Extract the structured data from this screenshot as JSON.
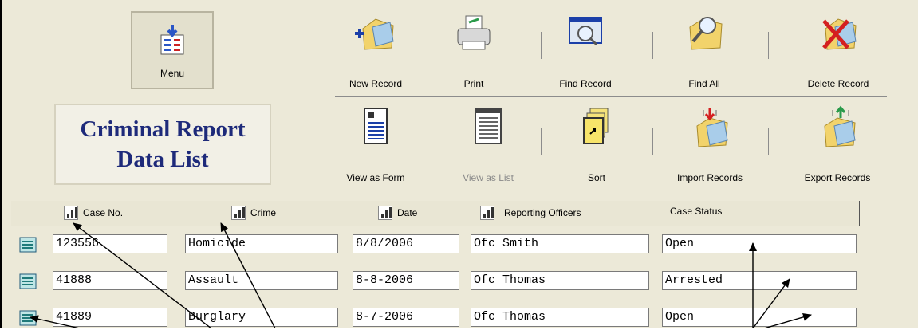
{
  "menu": {
    "label": "Menu"
  },
  "title": {
    "line1": "Criminal Report",
    "line2": "Data List"
  },
  "toolbar": {
    "row1": [
      {
        "label": "New Record",
        "icon": "new-record-icon",
        "disabled": false
      },
      {
        "label": "Print",
        "icon": "printer-icon",
        "disabled": false
      },
      {
        "label": "Find Record",
        "icon": "find-record-icon",
        "disabled": false
      },
      {
        "label": "Find All",
        "icon": "find-all-icon",
        "disabled": false
      },
      {
        "label": "Delete Record",
        "icon": "delete-record-icon",
        "disabled": false
      }
    ],
    "row2": [
      {
        "label": "View as Form",
        "icon": "view-as-form-icon",
        "disabled": false
      },
      {
        "label": "View as List",
        "icon": "view-as-list-icon",
        "disabled": true
      },
      {
        "label": "Sort",
        "icon": "sort-icon",
        "disabled": false
      },
      {
        "label": "Import Records",
        "icon": "import-records-icon",
        "disabled": false
      },
      {
        "label": "Export Records",
        "icon": "export-records-icon",
        "disabled": false
      }
    ]
  },
  "columns": [
    "Case No.",
    "Crime",
    "Date",
    "Reporting Officers",
    "Case Status"
  ],
  "rows": [
    {
      "case_no": "123556",
      "crime": "Homicide",
      "date": "8/8/2006",
      "officer": "Ofc Smith",
      "status": "Open"
    },
    {
      "case_no": "41888",
      "crime": "Assault",
      "date": "8-8-2006",
      "officer": "Ofc Thomas",
      "status": "Arrested"
    },
    {
      "case_no": "41889",
      "crime": "Burglary",
      "date": "8-7-2006",
      "officer": "Ofc Thomas",
      "status": "Open"
    }
  ],
  "colors": {
    "title_text": "#1e2a7a",
    "panel_bg": "#ece9d8",
    "row_icon": "#1f7a7a"
  }
}
